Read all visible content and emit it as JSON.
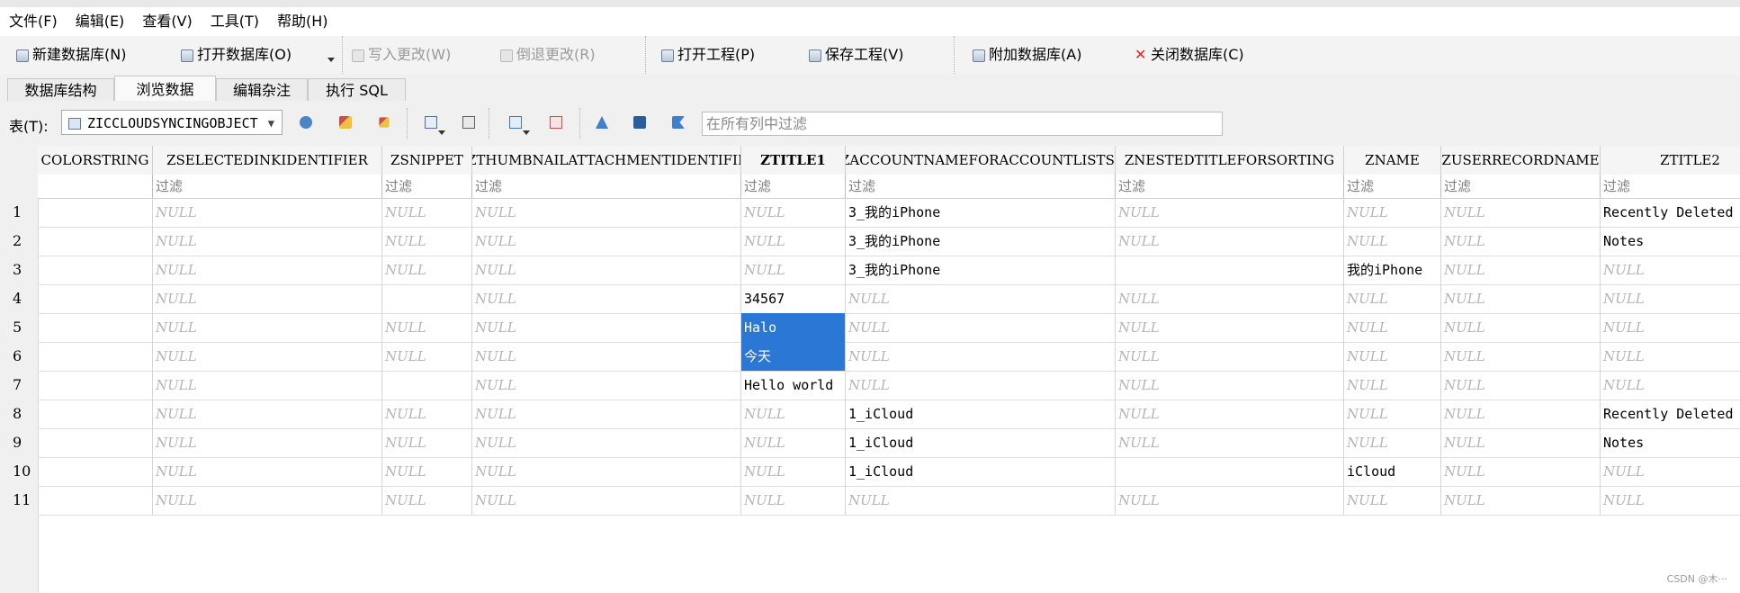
{
  "menubar": {
    "items": [
      "文件(F)",
      "编辑(E)",
      "查看(V)",
      "工具(T)",
      "帮助(H)"
    ]
  },
  "toolbar": {
    "new_db": "新建数据库(N)",
    "open_db": "打开数据库(O)",
    "write_changes": "写入更改(W)",
    "revert_changes": "倒退更改(R)",
    "open_project": "打开工程(P)",
    "save_project": "保存工程(V)",
    "attach_db": "附加数据库(A)",
    "close_db": "关闭数据库(C)"
  },
  "tabs": [
    "数据库结构",
    "浏览数据",
    "编辑杂注",
    "执行 SQL"
  ],
  "active_tab": "浏览数据",
  "filterbar": {
    "table_label": "表(T):",
    "table_selected": "ZICCLOUDSYNCINGOBJECT",
    "global_filter_placeholder": "在所有列中过滤"
  },
  "grid": {
    "columns": [
      "COLORSTRING",
      "ZSELECTEDINKIDENTIFIER",
      "ZSNIPPET",
      "ZTHUMBNAILATTACHMENTIDENTIFIER",
      "ZTITLE1",
      "ZACCOUNTNAMEFORACCOUNTLISTSORTING",
      "ZNESTEDTITLEFORSORTING",
      "ZNAME",
      "ZUSERRECORDNAME",
      "ZTITLE2"
    ],
    "filter_placeholder": "过滤",
    "null_text": "NULL",
    "rows": [
      {
        "num": "1",
        "cells": [
          "",
          "NULL",
          "NULL",
          "NULL",
          "NULL",
          "3_我的iPhone",
          "NULL",
          "NULL",
          "NULL",
          "Recently Deleted"
        ]
      },
      {
        "num": "2",
        "cells": [
          "",
          "NULL",
          "NULL",
          "NULL",
          "NULL",
          "3_我的iPhone",
          "NULL",
          "NULL",
          "NULL",
          "Notes"
        ]
      },
      {
        "num": "3",
        "cells": [
          "",
          "NULL",
          "NULL",
          "NULL",
          "NULL",
          "3_我的iPhone",
          "",
          "我的iPhone",
          "NULL",
          "NULL"
        ]
      },
      {
        "num": "4",
        "cells": [
          "",
          "NULL",
          "",
          "NULL",
          "34567",
          "NULL",
          "NULL",
          "NULL",
          "NULL",
          "NULL"
        ]
      },
      {
        "num": "5",
        "cells": [
          "",
          "NULL",
          "NULL",
          "NULL",
          "Halo",
          "NULL",
          "NULL",
          "NULL",
          "NULL",
          "NULL"
        ]
      },
      {
        "num": "6",
        "cells": [
          "",
          "NULL",
          "NULL",
          "NULL",
          "今天",
          "NULL",
          "NULL",
          "NULL",
          "NULL",
          "NULL"
        ]
      },
      {
        "num": "7",
        "cells": [
          "",
          "NULL",
          "",
          "NULL",
          "Hello world",
          "NULL",
          "NULL",
          "NULL",
          "NULL",
          "NULL"
        ]
      },
      {
        "num": "8",
        "cells": [
          "",
          "NULL",
          "NULL",
          "NULL",
          "NULL",
          "1_iCloud",
          "NULL",
          "NULL",
          "NULL",
          "Recently Deleted"
        ]
      },
      {
        "num": "9",
        "cells": [
          "",
          "NULL",
          "NULL",
          "NULL",
          "NULL",
          "1_iCloud",
          "NULL",
          "NULL",
          "NULL",
          "Notes"
        ]
      },
      {
        "num": "10",
        "cells": [
          "",
          "NULL",
          "NULL",
          "NULL",
          "NULL",
          "1_iCloud",
          "",
          "iCloud",
          "NULL",
          "NULL"
        ]
      },
      {
        "num": "11",
        "cells": [
          "",
          "NULL",
          "NULL",
          "NULL",
          "NULL",
          "NULL",
          "NULL",
          "NULL",
          "NULL",
          "NULL"
        ]
      }
    ],
    "selected_cells": [
      "4-4",
      "5-4"
    ]
  },
  "watermark": "CSDN @木···",
  "colors": {
    "selection": "#2a77d6",
    "null_text": "#b4b4b4"
  }
}
